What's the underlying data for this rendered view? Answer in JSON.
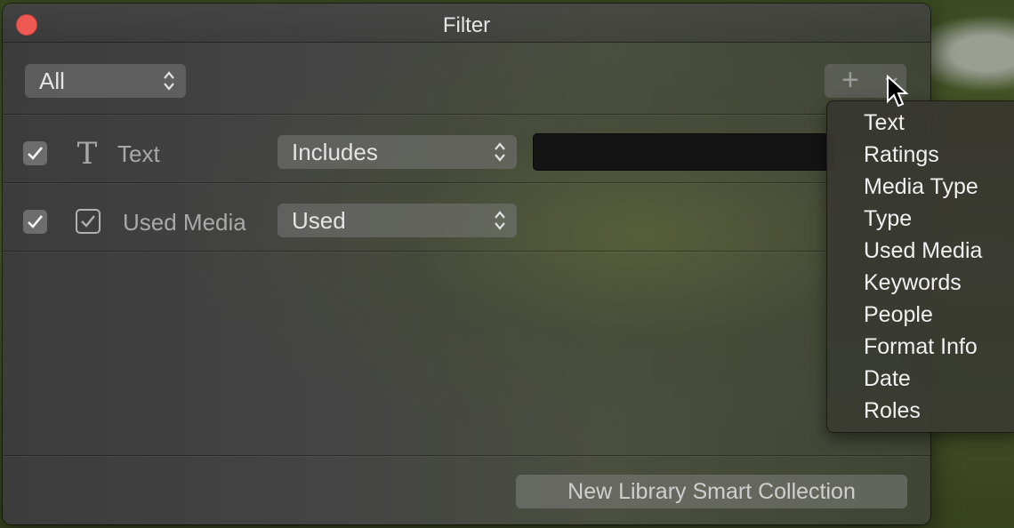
{
  "window": {
    "title": "Filter"
  },
  "match_select": {
    "value": "All"
  },
  "rules": [
    {
      "label": "Text",
      "icon": "text-icon",
      "operator": "Includes",
      "value": ""
    },
    {
      "label": "Used Media",
      "icon": "checkbox-icon",
      "operator": "Used"
    }
  ],
  "add_button": {
    "label": "+"
  },
  "add_menu": {
    "items": [
      "Text",
      "Ratings",
      "Media Type",
      "Type",
      "Used Media",
      "Keywords",
      "People",
      "Format Info",
      "Date",
      "Roles"
    ]
  },
  "footer": {
    "new_collection_label": "New Library Smart Collection"
  },
  "colors": {
    "close": "#ee5a52",
    "window_bg": "#444444",
    "field_bg": "#141414"
  }
}
